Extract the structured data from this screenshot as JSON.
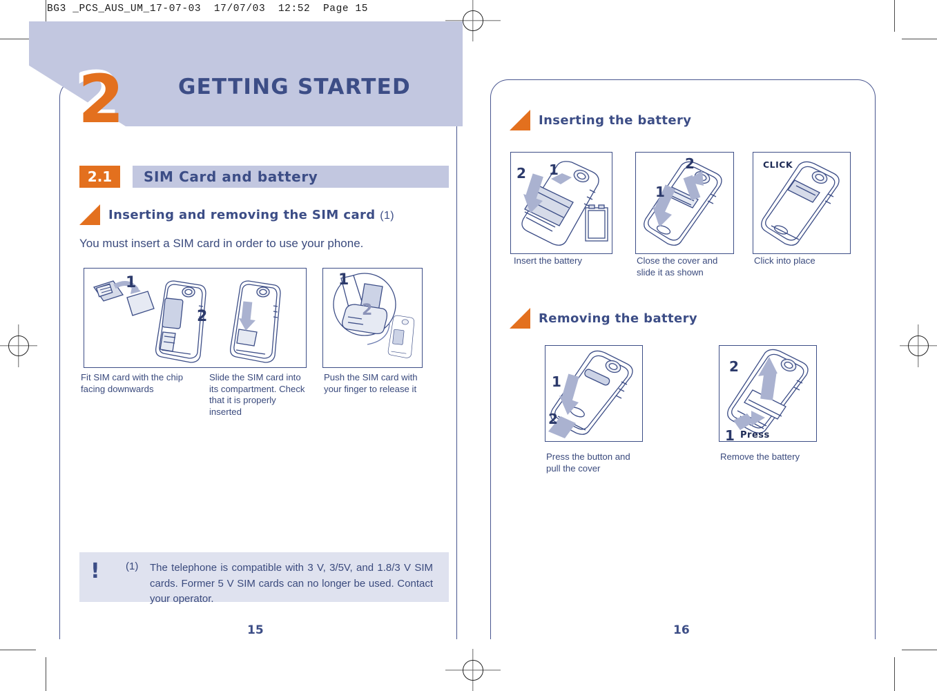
{
  "print_slug": "BG3 _PCS_AUS_UM_17-07-03  17/07/03  12:52  Page 15",
  "colors": {
    "orange": "#e3701e",
    "header_blue": "#c2c7e0",
    "text_blue": "#3a4a7d",
    "title_blue": "#3c4d86",
    "footnote_bg": "#dfe2ef"
  },
  "chapter": {
    "number": "2",
    "title": "GETTING STARTED"
  },
  "left_page": {
    "section": {
      "number": "2.1",
      "title": "SIM Card and battery"
    },
    "subheading": "Inserting and removing the SIM card",
    "subheading_footnote_ref": "(1)",
    "intro": "You must insert a SIM card in order to use your phone.",
    "figures": [
      {
        "name": "sim-fit-figure",
        "labels": [
          "1",
          "2"
        ],
        "caption": "Fit SIM card with the chip facing downwards"
      },
      {
        "name": "sim-slide-figure",
        "labels": [],
        "caption": "Slide the SIM card into its compartment. Check that it is properly inserted"
      },
      {
        "name": "sim-release-figure",
        "labels": [
          "1",
          "2"
        ],
        "caption": "Push the SIM card with your finger to release it"
      }
    ],
    "footnote": {
      "icon": "!",
      "marker": "(1)",
      "text": "The telephone is compatible with 3 V, 3/5V, and 1.8/3 V SIM cards. Former 5 V SIM cards can no longer be used. Contact your operator."
    },
    "page_number": "15"
  },
  "right_page": {
    "sections": [
      {
        "heading": "Inserting the battery",
        "figures": [
          {
            "name": "insert-battery-figure",
            "labels": [
              "2",
              "1"
            ],
            "caption": "Insert the battery"
          },
          {
            "name": "close-cover-figure",
            "labels": [
              "2",
              "1"
            ],
            "caption": "Close the cover and slide it as shown"
          },
          {
            "name": "click-place-figure",
            "labels": [
              "CLICK"
            ],
            "caption": "Click into place"
          }
        ]
      },
      {
        "heading": "Removing the battery",
        "figures": [
          {
            "name": "press-pull-cover-figure",
            "labels": [
              "1",
              "2"
            ],
            "caption": "Press the button and pull the cover"
          },
          {
            "name": "remove-battery-figure",
            "labels": [
              "2",
              "1",
              "Press"
            ],
            "caption": "Remove the battery"
          }
        ]
      }
    ],
    "page_number": "16"
  }
}
